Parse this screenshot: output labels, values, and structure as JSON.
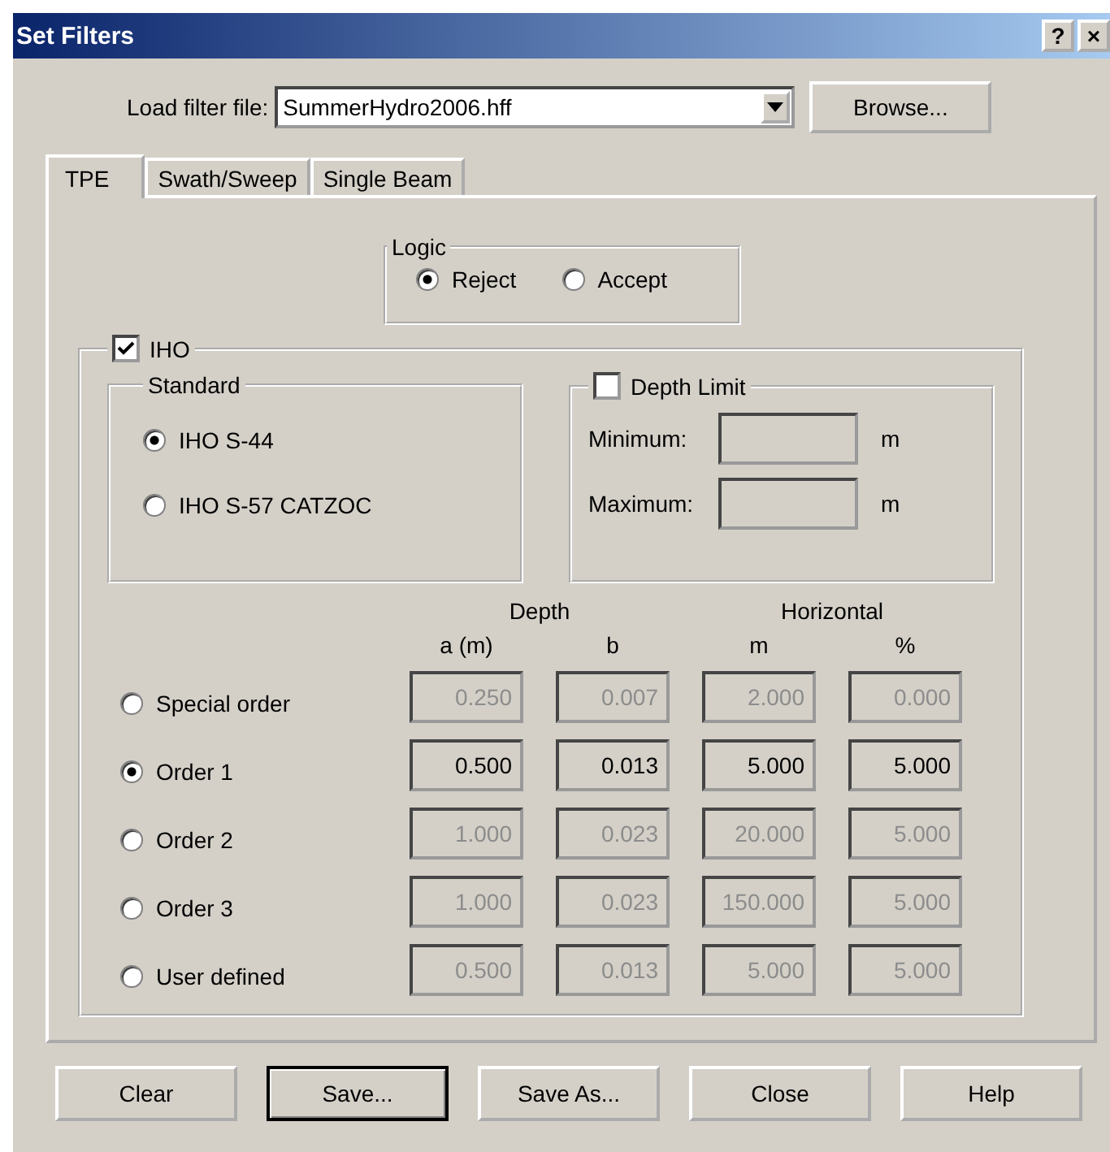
{
  "window": {
    "title": "Set Filters",
    "help_glyph": "?",
    "close_glyph": "×"
  },
  "load": {
    "label": "Load filter file:",
    "value": "SummerHydro2006.hff",
    "browse": "Browse..."
  },
  "tabs": [
    {
      "label": "TPE",
      "selected": true
    },
    {
      "label": "Swath/Sweep",
      "selected": false
    },
    {
      "label": "Single Beam",
      "selected": false
    }
  ],
  "logic": {
    "title": "Logic",
    "options": [
      {
        "label": "Reject",
        "selected": true
      },
      {
        "label": "Accept",
        "selected": false
      }
    ]
  },
  "iho": {
    "label": "IHO",
    "checked": true
  },
  "standard": {
    "title": "Standard",
    "options": [
      {
        "label": "IHO S-44",
        "selected": true
      },
      {
        "label": "IHO S-57 CATZOC",
        "selected": false
      }
    ]
  },
  "depth_limit": {
    "label": "Depth Limit",
    "checked": false,
    "fields": [
      {
        "label": "Minimum:",
        "unit": "m"
      },
      {
        "label": "Maximum:",
        "unit": "m"
      }
    ]
  },
  "orders": {
    "group_headers": [
      "Depth",
      "Horizontal"
    ],
    "columns": [
      "a (m)",
      "b",
      "m",
      "%"
    ],
    "rows": [
      {
        "label": "Special order",
        "selected": false,
        "values": [
          "0.250",
          "0.007",
          "2.000",
          "0.000"
        ]
      },
      {
        "label": "Order 1",
        "selected": true,
        "values": [
          "0.500",
          "0.013",
          "5.000",
          "5.000"
        ]
      },
      {
        "label": "Order 2",
        "selected": false,
        "values": [
          "1.000",
          "0.023",
          "20.000",
          "5.000"
        ]
      },
      {
        "label": "Order 3",
        "selected": false,
        "values": [
          "1.000",
          "0.023",
          "150.000",
          "5.000"
        ]
      },
      {
        "label": "User defined",
        "selected": false,
        "values": [
          "0.500",
          "0.013",
          "5.000",
          "5.000"
        ]
      }
    ]
  },
  "buttons": [
    {
      "label": "Clear",
      "default": false
    },
    {
      "label": "Save...",
      "default": true
    },
    {
      "label": "Save As...",
      "default": false
    },
    {
      "label": "Close",
      "default": false
    },
    {
      "label": "Help",
      "default": false
    }
  ]
}
